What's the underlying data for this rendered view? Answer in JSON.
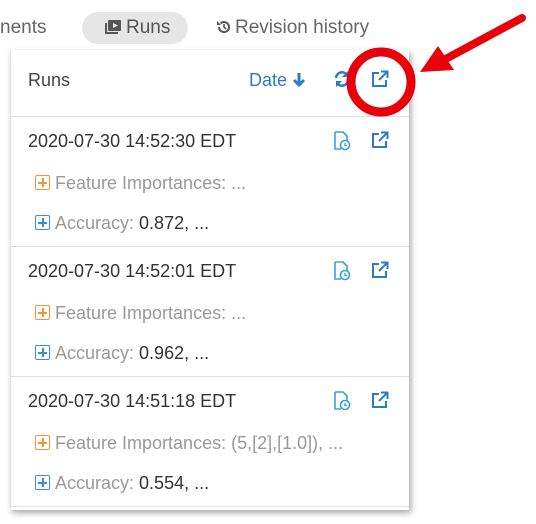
{
  "tabs": [
    {
      "label": "nents"
    },
    {
      "label": "Runs",
      "icon": "runs-icon",
      "active": true
    },
    {
      "label": "Revision history",
      "icon": "history-icon"
    }
  ],
  "panel": {
    "title": "Runs",
    "sort_label": "Date",
    "sort_direction": "descending"
  },
  "runs": [
    {
      "date": "2020-07-30 14:52:30 EDT",
      "feature_label": "Feature Importances:",
      "feature_value": "...",
      "accuracy_label": "Accuracy:",
      "accuracy_value": "0.872, ..."
    },
    {
      "date": "2020-07-30 14:52:01 EDT",
      "feature_label": "Feature Importances:",
      "feature_value": "...",
      "accuracy_label": "Accuracy:",
      "accuracy_value": "0.962, ..."
    },
    {
      "date": "2020-07-30 14:51:18 EDT",
      "feature_label": "Feature Importances:",
      "feature_value": "(5,[2],[1.0]), ...",
      "accuracy_label": "Accuracy:",
      "accuracy_value": "0.554, ..."
    }
  ],
  "colors": {
    "accent": "#2e7bc4",
    "feature": "#f0963a",
    "metric": "#3a8fd0",
    "annotation": "#e8000b"
  }
}
